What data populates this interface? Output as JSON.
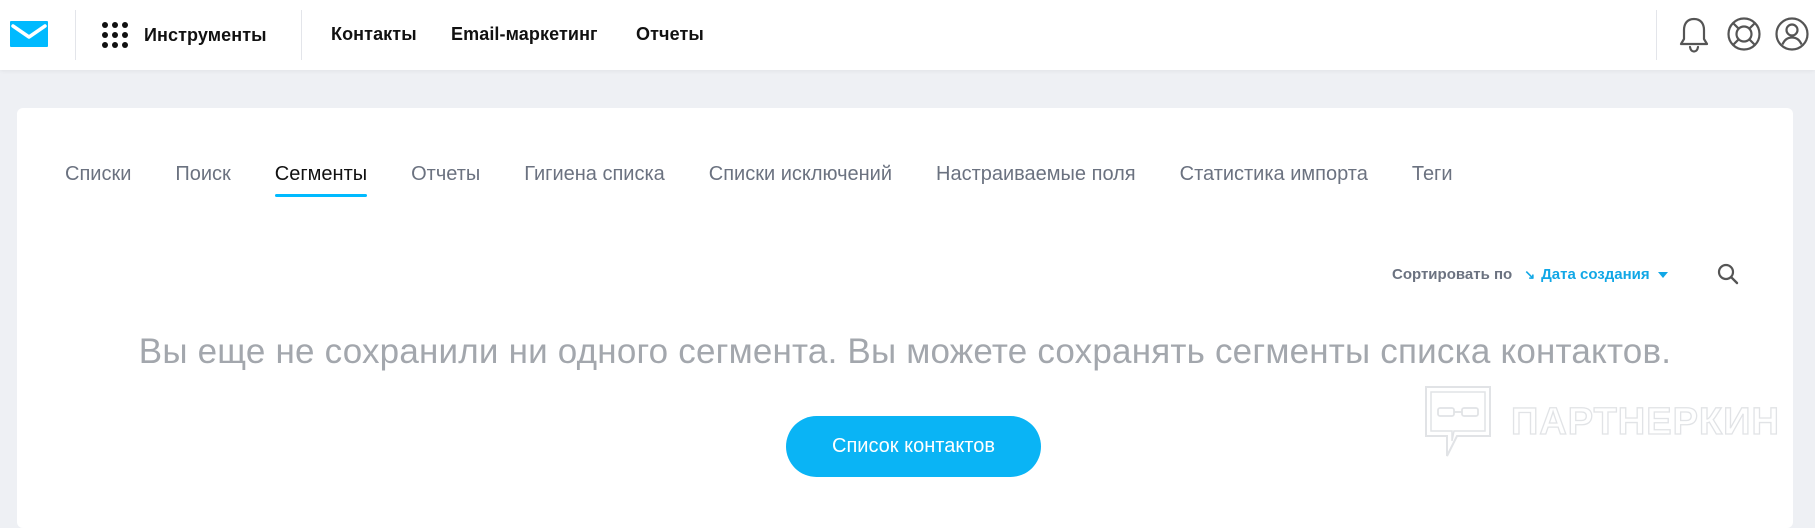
{
  "header": {
    "tools_label": "Инструменты",
    "nav": [
      {
        "label": "Контакты"
      },
      {
        "label": "Email-маркетинг"
      },
      {
        "label": "Отчеты"
      }
    ],
    "icons": [
      "bell-icon",
      "help-lifebuoy-icon",
      "user-profile-icon"
    ]
  },
  "tabs": [
    {
      "label": "Списки",
      "active": false
    },
    {
      "label": "Поиск",
      "active": false
    },
    {
      "label": "Сегменты",
      "active": true
    },
    {
      "label": "Отчеты",
      "active": false
    },
    {
      "label": "Гигиена списка",
      "active": false
    },
    {
      "label": "Списки исключений",
      "active": false
    },
    {
      "label": "Настраиваемые поля",
      "active": false
    },
    {
      "label": "Статистика импорта",
      "active": false
    },
    {
      "label": "Теги",
      "active": false
    }
  ],
  "sort": {
    "label": "Сортировать по",
    "value": "Дата создания"
  },
  "empty_state": {
    "message": "Вы еще не сохранили ни одного сегмента. Вы можете сохранять сегменты списка контактов.",
    "button_label": "Список контактов"
  },
  "watermark": {
    "text": "ПАРТНЕРКИН"
  },
  "colors": {
    "accent": "#00baff",
    "button": "#0ab4f5",
    "sort_link": "#11a7e6",
    "muted_text": "#a3a7ad",
    "page_bg": "#eef0f4"
  }
}
